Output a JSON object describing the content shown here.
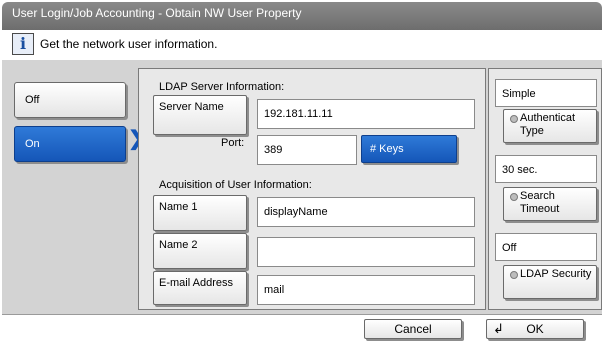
{
  "window": {
    "title": "User Login/Job Accounting - Obtain NW User Property"
  },
  "info": {
    "icon": "info-icon",
    "message": "Get the network user information."
  },
  "mode": {
    "off_label": "Off",
    "on_label": "On",
    "selected": "On"
  },
  "ldap_server": {
    "section_label": "LDAP Server Information:",
    "server_name_label": "Server Name",
    "server_name_value": "192.181.11.11",
    "port_label": "Port:",
    "port_value": "389",
    "keys_label": "# Keys"
  },
  "acquisition": {
    "section_label": "Acquisition of User Information:",
    "name1_label": "Name 1",
    "name1_value": "displayName",
    "name2_label": "Name 2",
    "name2_value": "",
    "email_label": "E-mail Address",
    "email_value": "mail"
  },
  "settings": {
    "auth_value": "Simple",
    "auth_button": "Authenticat Type",
    "timeout_value": "30 sec.",
    "timeout_button": "Search Timeout",
    "security_value": "Off",
    "security_button": "LDAP Security"
  },
  "footer": {
    "cancel_label": "Cancel",
    "ok_label": "OK",
    "ok_icon": "enter-icon"
  },
  "colors": {
    "selected_blue": "#1556b8",
    "panel_gray": "#d3d3d3",
    "title_gray": "#7a7a7a"
  }
}
